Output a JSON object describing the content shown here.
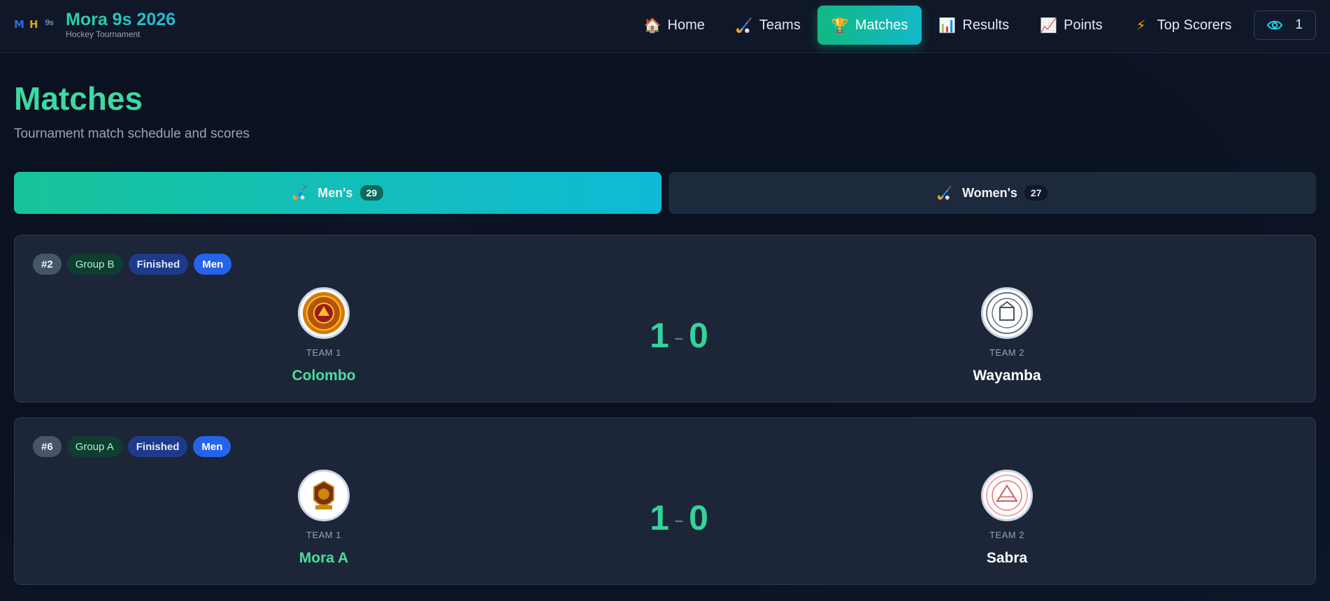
{
  "header": {
    "title": "Mora 9s 2026",
    "subtitle": "Hockey Tournament",
    "nav": [
      {
        "label": "Home",
        "icon": "house-icon"
      },
      {
        "label": "Teams",
        "icon": "hockey-stick-icon"
      },
      {
        "label": "Matches",
        "icon": "trophy-icon",
        "active": true
      },
      {
        "label": "Results",
        "icon": "bar-chart-icon"
      },
      {
        "label": "Points",
        "icon": "line-chart-icon"
      },
      {
        "label": "Top Scorers",
        "icon": "lightning-icon"
      }
    ],
    "viewer_count": "1"
  },
  "page": {
    "title": "Matches",
    "subtitle": "Tournament match schedule and scores"
  },
  "category_tabs": [
    {
      "label": "Men's",
      "count": "29",
      "active": true
    },
    {
      "label": "Women's",
      "count": "27",
      "active": false
    }
  ],
  "matches": [
    {
      "number": "#2",
      "group": "Group B",
      "status": "Finished",
      "gender": "Men",
      "team1": {
        "role": "TEAM 1",
        "name": "Colombo"
      },
      "team2": {
        "role": "TEAM 2",
        "name": "Wayamba"
      },
      "score1": "1",
      "score2": "0"
    },
    {
      "number": "#6",
      "group": "Group A",
      "status": "Finished",
      "gender": "Men",
      "team1": {
        "role": "TEAM 1",
        "name": "Mora A"
      },
      "team2": {
        "role": "TEAM 2",
        "name": "Sabra"
      },
      "score1": "1",
      "score2": "0"
    }
  ],
  "colors": {
    "accent": "#10b981",
    "accent2": "#14b8c8",
    "background": "#0b1324",
    "card": "#1c2638"
  }
}
